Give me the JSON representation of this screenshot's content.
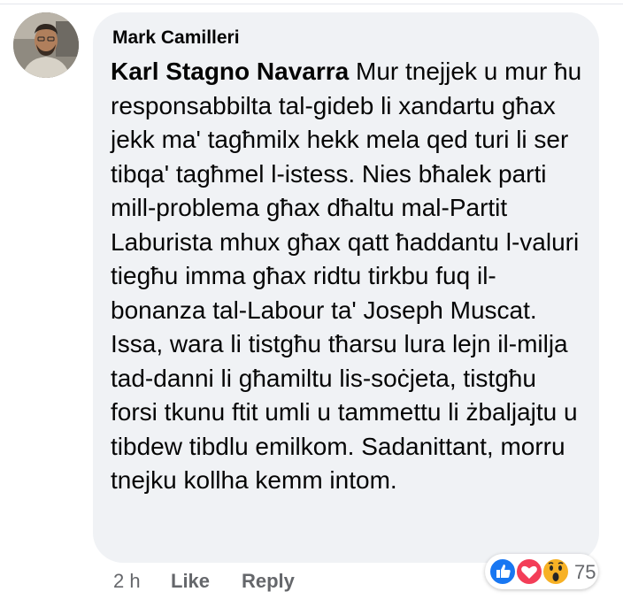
{
  "comment": {
    "author": "Mark Camilleri",
    "mention": "Karl Stagno Navarra",
    "text": "Mur tnejjek u mur ħu responsabbilta tal-gideb li xandartu għax jekk ma' tagħmilx hekk mela qed turi li ser tibqa' tagħmel l-istess. Nies bħalek parti mill-problema għax dħaltu mal-Partit Laburista mhux għax qatt ħaddantu l-valuri tiegħu imma għax ridtu tirkbu fuq il-bonanza tal-Labour ta' Joseph Muscat. Issa, wara li tistgħu tħarsu lura lejn il-milja tad-danni li għamiltu lis-soċjeta, tistgħu forsi tkunu ftit umli u tammettu li żbaljajtu u tibdew tibdlu emilkom. Sadanittant, morru tnejku kollha kemm intom.",
    "time": "2 h",
    "like_label": "Like",
    "reply_label": "Reply",
    "reactions": {
      "icons": [
        "like-icon",
        "love-icon",
        "wow-icon"
      ],
      "count": "75"
    }
  },
  "colors": {
    "bubble": "#f0f2f5",
    "text": "#050505",
    "meta": "#65676b",
    "like_blue": "#1877f2",
    "love_red": "#f33e58",
    "wow_yellow": "#f7b125"
  }
}
